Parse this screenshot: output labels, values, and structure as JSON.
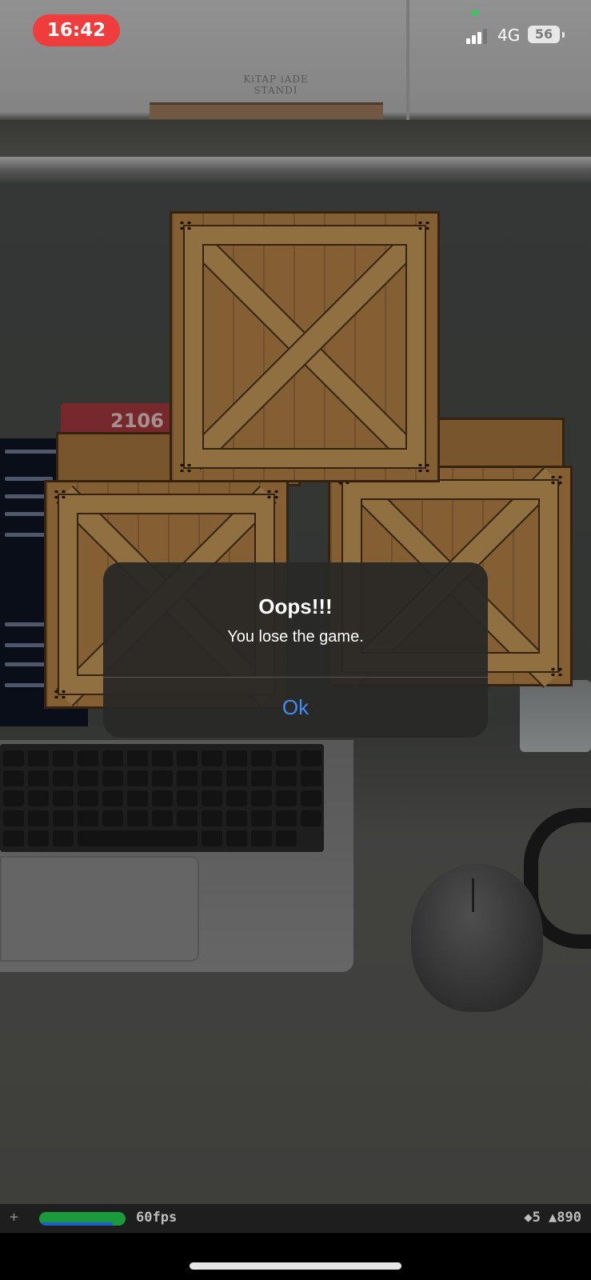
{
  "status_bar": {
    "time": "16:42",
    "network": "4G",
    "battery": "56"
  },
  "scene": {
    "wall_sign_line1": "KiTAP iADE",
    "wall_sign_line2": "STANDI",
    "tag_number": "2106"
  },
  "alert": {
    "title": "Oops!!!",
    "message": "You lose the game.",
    "ok_label": "Ok"
  },
  "debug_bar": {
    "plus": "+",
    "fps_label": "60fps",
    "stats": "◆5 ▲890"
  },
  "colors": {
    "time_pill": "#ef3d3d",
    "alert_button": "#3f8ef7",
    "fps_bar": "#1a9a3c"
  }
}
